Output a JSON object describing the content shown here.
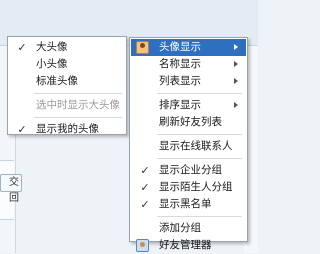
{
  "background": {
    "button_label": "交回"
  },
  "avatar_submenu": {
    "items": [
      {
        "label": "大头像",
        "checked": true,
        "disabled": false
      },
      {
        "label": "小头像",
        "checked": false,
        "disabled": false
      },
      {
        "label": "标准头像",
        "checked": false,
        "disabled": false
      },
      {
        "label": "选中时显示大头像",
        "checked": false,
        "disabled": true
      },
      {
        "label": "显示我的头像",
        "checked": true,
        "disabled": false
      }
    ]
  },
  "main_menu": {
    "items": [
      {
        "label": "头像显示",
        "icon": "avatar-icon",
        "submenu": true,
        "highlighted": true
      },
      {
        "label": "名称显示",
        "submenu": true
      },
      {
        "label": "列表显示",
        "submenu": true
      },
      {
        "label": "排序显示",
        "submenu": true
      },
      {
        "label": "刷新好友列表"
      },
      {
        "label": "显示在线联系人"
      },
      {
        "label": "显示企业分组",
        "checked": true
      },
      {
        "label": "显示陌生人分组",
        "checked": true
      },
      {
        "label": "显示黑名单",
        "checked": true
      },
      {
        "label": "添加分组"
      },
      {
        "label": "好友管理器",
        "icon": "friend-manager-icon"
      }
    ]
  },
  "colors": {
    "highlight": "#2f6fc0",
    "menu_border": "#9aa4ae",
    "disabled_text": "#9a9a9a"
  }
}
